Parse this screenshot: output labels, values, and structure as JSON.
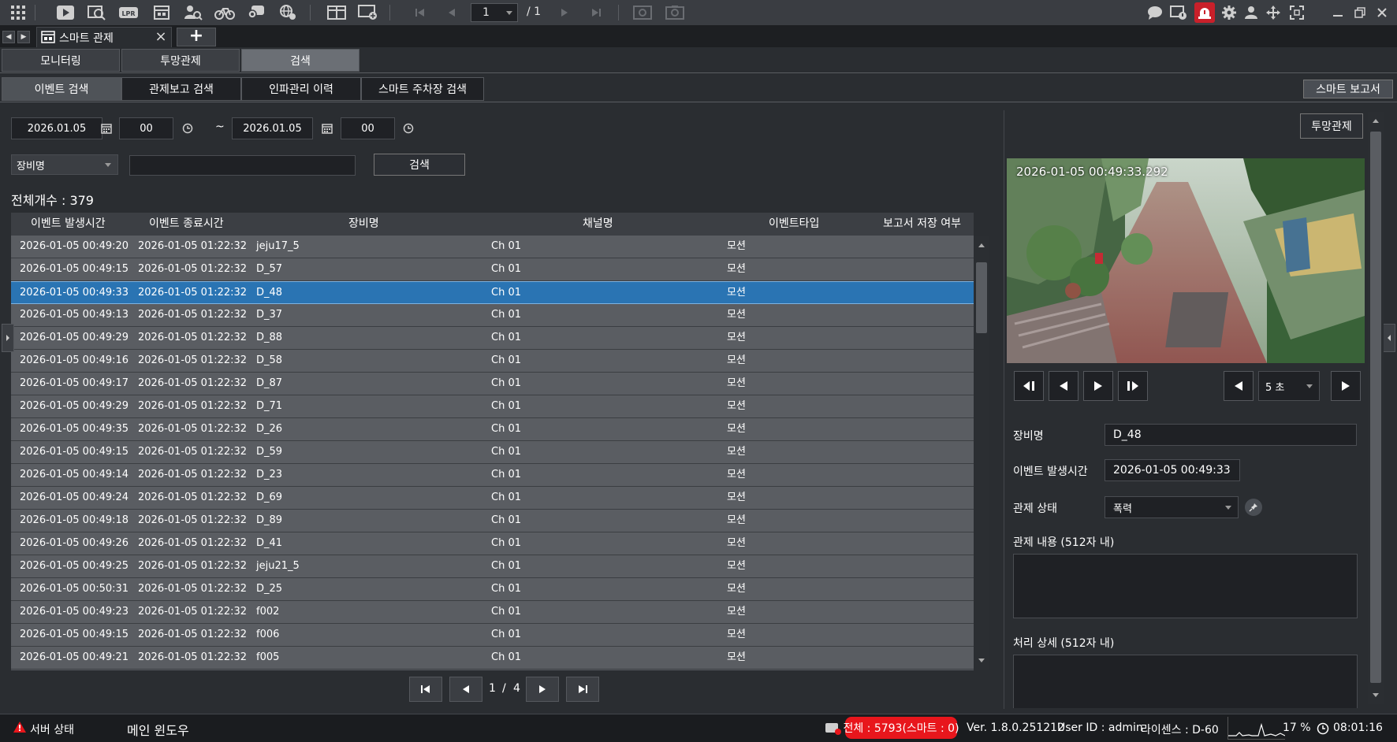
{
  "toolbar": {
    "page_current": "1",
    "page_total": "/ 1"
  },
  "tabbar": {
    "doc_tab_label": "스마트 관제",
    "add_tab_label": "+"
  },
  "main_tabs": [
    {
      "label": "모니터링"
    },
    {
      "label": "투망관제"
    },
    {
      "label": "검색"
    }
  ],
  "sub_tabs": [
    {
      "label": "이벤트 검색"
    },
    {
      "label": "관제보고 검색"
    },
    {
      "label": "인파관리 이력"
    },
    {
      "label": "스마트 주차장 검색"
    }
  ],
  "smart_report_label": "스마트 보고서",
  "search": {
    "start_date": "2026.01.05",
    "start_hour": "00",
    "tilde": "~",
    "end_date": "2026.01.05",
    "end_hour": "00",
    "filter_field": "장비명",
    "keyword": "",
    "search_button": "검색"
  },
  "total_count": "전체개수 : 379",
  "table": {
    "columns": [
      "이벤트 발생시간",
      "이벤트 종료시간",
      "장비명",
      "채널명",
      "이벤트타입",
      "보고서 저장 여부"
    ],
    "rows": [
      [
        "2026-01-05 00:49:20",
        "2026-01-05 01:22:32",
        "jeju17_5",
        "Ch 01",
        "모션",
        ""
      ],
      [
        "2026-01-05 00:49:15",
        "2026-01-05 01:22:32",
        "D_57",
        "Ch 01",
        "모션",
        ""
      ],
      [
        "2026-01-05 00:49:33",
        "2026-01-05 01:22:32",
        "D_48",
        "Ch 01",
        "모션",
        ""
      ],
      [
        "2026-01-05 00:49:13",
        "2026-01-05 01:22:32",
        "D_37",
        "Ch 01",
        "모션",
        ""
      ],
      [
        "2026-01-05 00:49:29",
        "2026-01-05 01:22:32",
        "D_88",
        "Ch 01",
        "모션",
        ""
      ],
      [
        "2026-01-05 00:49:16",
        "2026-01-05 01:22:32",
        "D_58",
        "Ch 01",
        "모션",
        ""
      ],
      [
        "2026-01-05 00:49:17",
        "2026-01-05 01:22:32",
        "D_87",
        "Ch 01",
        "모션",
        ""
      ],
      [
        "2026-01-05 00:49:29",
        "2026-01-05 01:22:32",
        "D_71",
        "Ch 01",
        "모션",
        ""
      ],
      [
        "2026-01-05 00:49:35",
        "2026-01-05 01:22:32",
        "D_26",
        "Ch 01",
        "모션",
        ""
      ],
      [
        "2026-01-05 00:49:15",
        "2026-01-05 01:22:32",
        "D_59",
        "Ch 01",
        "모션",
        ""
      ],
      [
        "2026-01-05 00:49:14",
        "2026-01-05 01:22:32",
        "D_23",
        "Ch 01",
        "모션",
        ""
      ],
      [
        "2026-01-05 00:49:24",
        "2026-01-05 01:22:32",
        "D_69",
        "Ch 01",
        "모션",
        ""
      ],
      [
        "2026-01-05 00:49:18",
        "2026-01-05 01:22:32",
        "D_89",
        "Ch 01",
        "모션",
        ""
      ],
      [
        "2026-01-05 00:49:26",
        "2026-01-05 01:22:32",
        "D_41",
        "Ch 01",
        "모션",
        ""
      ],
      [
        "2026-01-05 00:49:25",
        "2026-01-05 01:22:32",
        "jeju21_5",
        "Ch 01",
        "모션",
        ""
      ],
      [
        "2026-01-05 00:50:31",
        "2026-01-05 01:22:32",
        "D_25",
        "Ch 01",
        "모션",
        ""
      ],
      [
        "2026-01-05 00:49:23",
        "2026-01-05 01:22:32",
        "f002",
        "Ch 01",
        "모션",
        ""
      ],
      [
        "2026-01-05 00:49:15",
        "2026-01-05 01:22:32",
        "f006",
        "Ch 01",
        "모션",
        ""
      ],
      [
        "2026-01-05 00:49:21",
        "2026-01-05 01:22:32",
        "f005",
        "Ch 01",
        "모션",
        ""
      ]
    ],
    "selected_row": 2
  },
  "pager": {
    "current": "1",
    "slash": "/",
    "total": "4"
  },
  "right_panel": {
    "tumang_button": "투망관제",
    "video_timestamp": "2026-01-05 00:49:33.292",
    "interval_value": "5 초",
    "device_label": "장비명",
    "device_value": "D_48",
    "event_time_label": "이벤트 발생시간",
    "event_time_value": "2026-01-05 00:49:33",
    "status_label": "관제 상태",
    "status_value": "폭력",
    "content_label": "관제 내용 (512자 내)",
    "detail_label": "처리 상세 (512자 내)"
  },
  "statusbar": {
    "server_status": "서버 상태",
    "main_window": "메인 윈도우",
    "total_alert": "전체 : 5793(스마트 : 0)",
    "version": "Ver. 1.8.0.251212",
    "user_id": "User ID : admin",
    "license": "라이센스 : D-60",
    "cpu_percent": "17 %",
    "clock": "08:01:16"
  },
  "colors": {
    "selected_row": "#2a74b3",
    "alert": "#e8161c"
  }
}
